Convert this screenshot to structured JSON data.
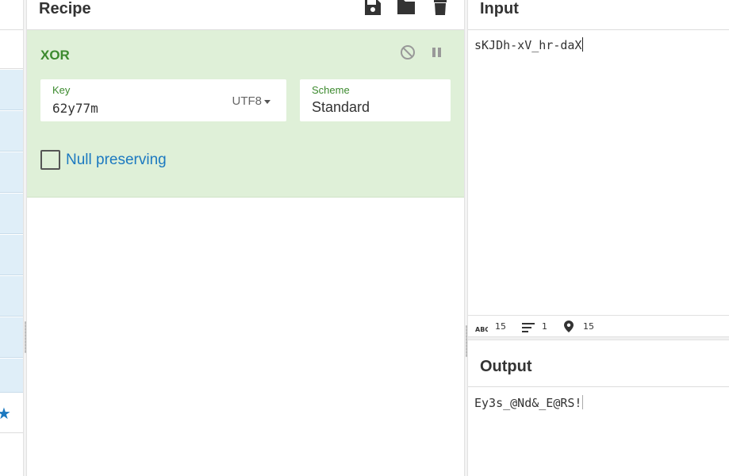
{
  "recipe": {
    "title": "Recipe",
    "icons": [
      "save-icon",
      "folder-icon",
      "trash-icon"
    ],
    "operation": {
      "name": "XOR",
      "key": {
        "label": "Key",
        "value": "62y77m",
        "encoding": "UTF8"
      },
      "scheme": {
        "label": "Scheme",
        "value": "Standard"
      },
      "null_preserving": {
        "label": "Null preserving",
        "checked": false
      },
      "icons": [
        "disable-icon",
        "pause-icon"
      ]
    }
  },
  "input": {
    "title": "Input",
    "text": "sKJDh-xV_hr-daX",
    "stats": {
      "length": "15",
      "lines": "1",
      "position": "15"
    }
  },
  "output": {
    "title": "Output",
    "text": "Ey3s_@Nd&_E@RS!"
  },
  "colors": {
    "operation_bg": "#dff0d8",
    "operation_title": "#3c8a2e",
    "link_blue": "#1c79c0",
    "sidebar_item_bg": "#dfeef8"
  }
}
